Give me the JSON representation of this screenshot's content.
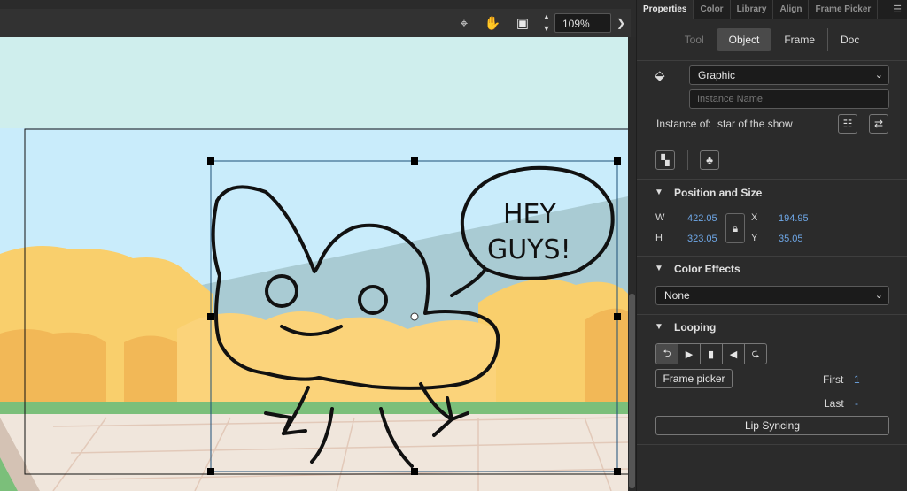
{
  "panel": {
    "tabs": [
      "Properties",
      "Color",
      "Library",
      "Align",
      "Frame Picker"
    ],
    "active_tab": "Properties",
    "mode_tabs": {
      "tool": "Tool",
      "object": "Object",
      "frame": "Frame",
      "doc": "Doc"
    },
    "symbol_type": "Graphic",
    "instance_name_placeholder": "Instance Name",
    "instance_of_label": "Instance of:",
    "instance_of_value": "star of the show",
    "position_size": {
      "title": "Position and Size",
      "w_label": "W",
      "w_value": "422.05",
      "h_label": "H",
      "h_value": "323.05",
      "x_label": "X",
      "x_value": "194.95",
      "y_label": "Y",
      "y_value": "35.05"
    },
    "color_effects": {
      "title": "Color Effects",
      "value": "None"
    },
    "looping": {
      "title": "Looping",
      "frame_picker_label": "Frame picker",
      "first_label": "First",
      "first_value": "1",
      "last_label": "Last",
      "last_value": "-",
      "lip_sync_label": "Lip Syncing"
    }
  },
  "toolbar": {
    "zoom": "109%"
  },
  "canvas": {
    "speech_bubble_text_line1": "HEY",
    "speech_bubble_text_line2": "GUYS!"
  },
  "colors": {
    "accent_value": "#6fa8e8",
    "panel_bg": "#2b2b2b",
    "sky": "#c9ecfb",
    "ground": "#f0e6dc"
  }
}
